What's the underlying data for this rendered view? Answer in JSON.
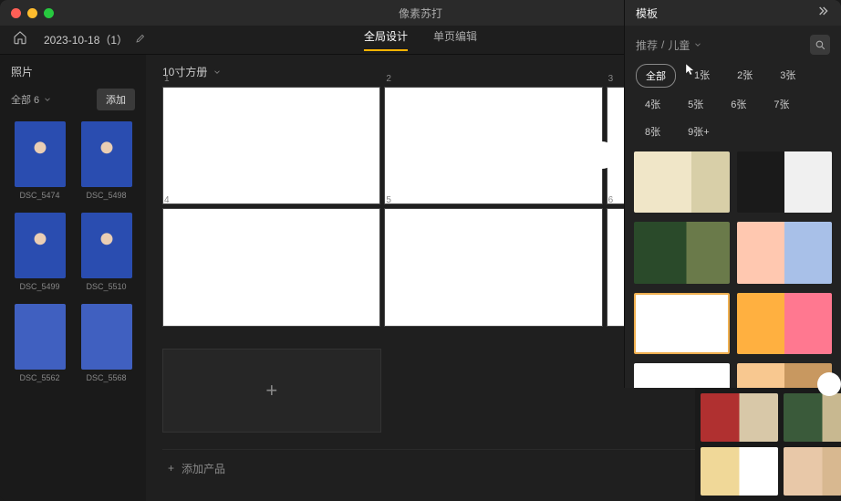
{
  "app_title": "像素苏打",
  "project": {
    "name": "2023-10-18（1）"
  },
  "header_tabs": {
    "global": "全局设计",
    "single": "单页编辑"
  },
  "left": {
    "title": "照片",
    "filter": "全部 6",
    "add": "添加",
    "thumbs": [
      {
        "label": "DSC_5474"
      },
      {
        "label": "DSC_5498"
      },
      {
        "label": "DSC_5499"
      },
      {
        "label": "DSC_5510"
      },
      {
        "label": "DSC_5562"
      },
      {
        "label": "DSC_5568"
      }
    ]
  },
  "center": {
    "size_label": "10寸方册",
    "pages": [
      "1",
      "2",
      "3",
      "4",
      "5",
      "6"
    ],
    "add_product": "添加产品"
  },
  "right": {
    "title": "模板",
    "breadcrumb_a": "推荐",
    "breadcrumb_sep": "/",
    "breadcrumb_b": "儿童",
    "chips": [
      "全部",
      "1张",
      "2张",
      "3张",
      "4张",
      "5张",
      "6张",
      "7张",
      "8张",
      "9张+"
    ]
  }
}
